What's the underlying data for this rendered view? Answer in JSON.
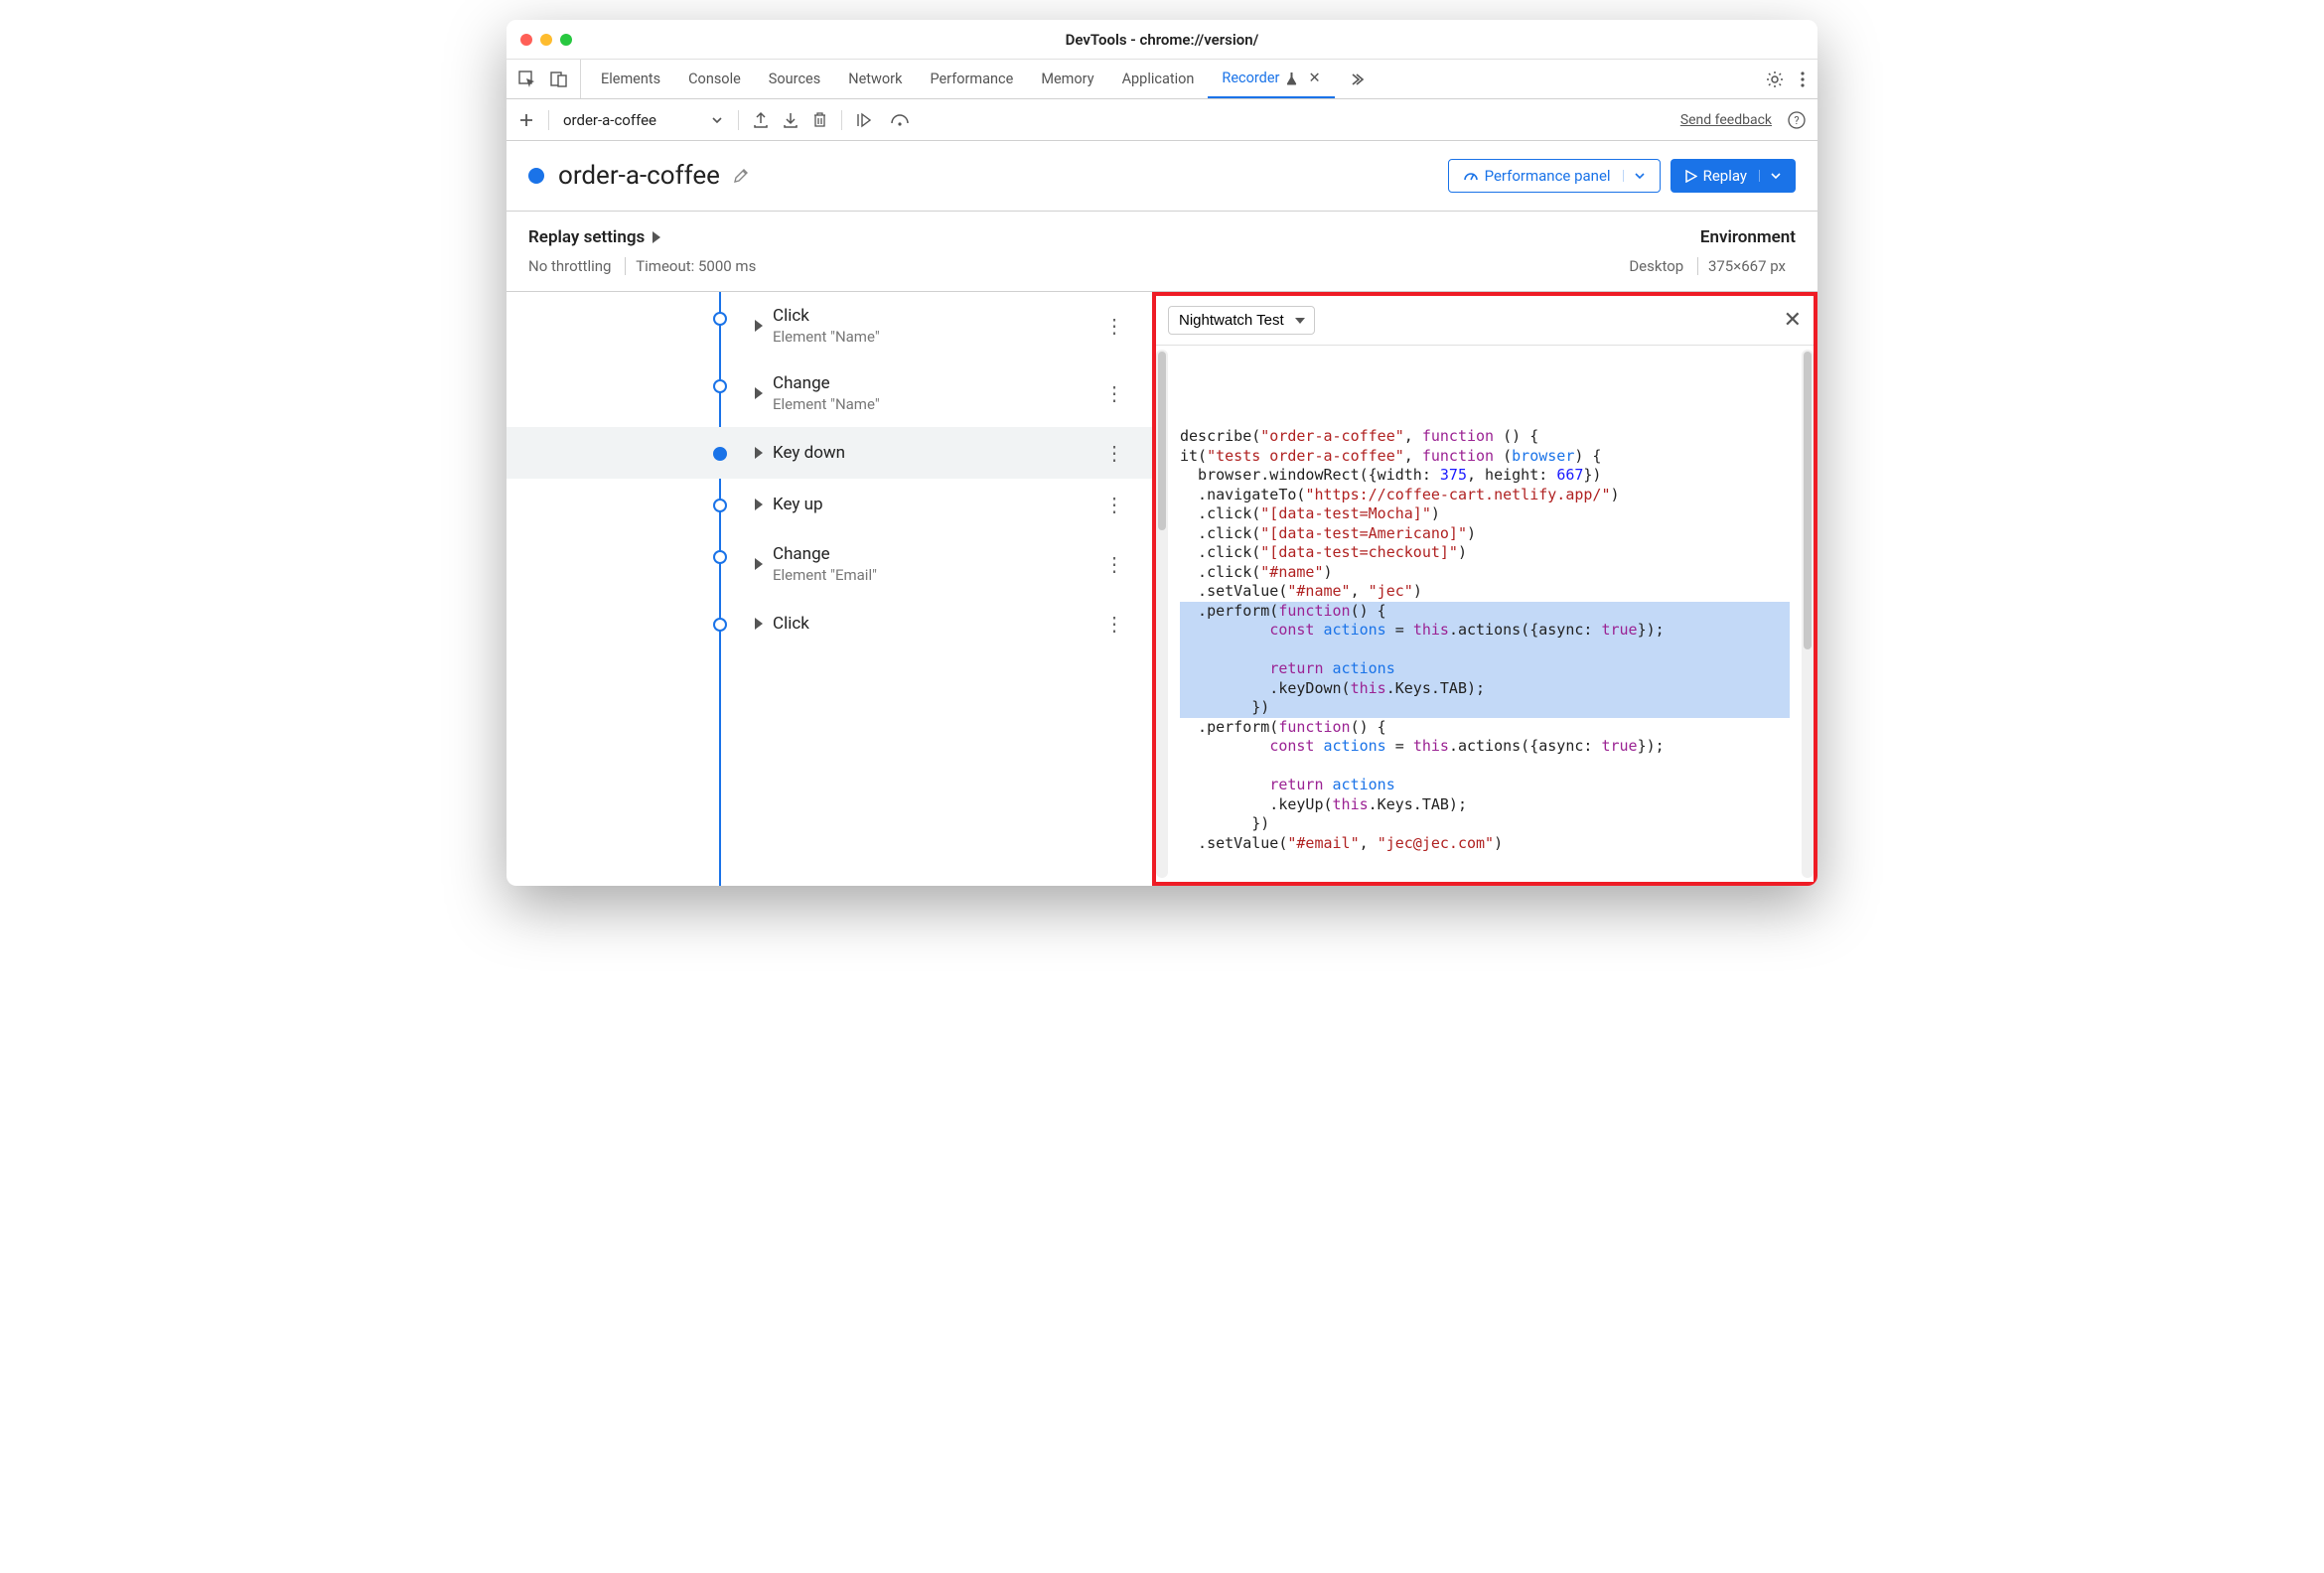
{
  "window_title": "DevTools - chrome://version/",
  "tabs": {
    "items": [
      "Elements",
      "Console",
      "Sources",
      "Network",
      "Performance",
      "Memory",
      "Application",
      "Recorder"
    ],
    "active_index": 7
  },
  "recorder_toolbar": {
    "recording_name": "order-a-coffee",
    "feedback": "Send feedback"
  },
  "header": {
    "title": "order-a-coffee",
    "perf_button": "Performance panel",
    "replay_button": "Replay"
  },
  "replay_settings": {
    "heading": "Replay settings",
    "throttling": "No throttling",
    "timeout": "Timeout: 5000 ms"
  },
  "environment": {
    "heading": "Environment",
    "device": "Desktop",
    "dimensions": "375×667 px"
  },
  "steps": [
    {
      "action": "Click",
      "elem": "Element \"Name\""
    },
    {
      "action": "Change",
      "elem": "Element \"Name\""
    },
    {
      "action": "Key down",
      "elem": ""
    },
    {
      "action": "Key up",
      "elem": ""
    },
    {
      "action": "Change",
      "elem": "Element \"Email\""
    },
    {
      "action": "Click",
      "elem": ""
    }
  ],
  "active_step_index": 2,
  "code_panel": {
    "format": "Nightwatch Test",
    "lines": [
      {
        "t": "describe(",
        "parts": [
          [
            "plain",
            "describe("
          ],
          [
            "str",
            "\"order-a-coffee\""
          ],
          [
            "plain",
            ", "
          ],
          [
            "kw",
            "function"
          ],
          [
            "plain",
            " () {"
          ]
        ]
      },
      {
        "t": "it",
        "parts": [
          [
            "plain",
            "it("
          ],
          [
            "str",
            "\"tests order-a-coffee\""
          ],
          [
            "plain",
            ", "
          ],
          [
            "kw",
            "function"
          ],
          [
            "plain",
            " ("
          ],
          [
            "id",
            "browser"
          ],
          [
            "plain",
            ") {"
          ]
        ]
      },
      {
        "t": "wr",
        "parts": [
          [
            "plain",
            "  browser.windowRect({width: "
          ],
          [
            "num",
            "375"
          ],
          [
            "plain",
            ", height: "
          ],
          [
            "num",
            "667"
          ],
          [
            "plain",
            "})"
          ]
        ]
      },
      {
        "t": "nav",
        "parts": [
          [
            "plain",
            "  .navigateTo("
          ],
          [
            "str",
            "\"https://coffee-cart.netlify.app/\""
          ],
          [
            "plain",
            ")"
          ]
        ]
      },
      {
        "t": "c1",
        "parts": [
          [
            "plain",
            "  .click("
          ],
          [
            "str",
            "\"[data-test=Mocha]\""
          ],
          [
            "plain",
            ")"
          ]
        ]
      },
      {
        "t": "c2",
        "parts": [
          [
            "plain",
            "  .click("
          ],
          [
            "str",
            "\"[data-test=Americano]\""
          ],
          [
            "plain",
            ")"
          ]
        ]
      },
      {
        "t": "c3",
        "parts": [
          [
            "plain",
            "  .click("
          ],
          [
            "str",
            "\"[data-test=checkout]\""
          ],
          [
            "plain",
            ")"
          ]
        ]
      },
      {
        "t": "c4",
        "parts": [
          [
            "plain",
            "  .click("
          ],
          [
            "str",
            "\"#name\""
          ],
          [
            "plain",
            ")"
          ]
        ]
      },
      {
        "t": "sv",
        "parts": [
          [
            "plain",
            "  .setValue("
          ],
          [
            "str",
            "\"#name\""
          ],
          [
            "plain",
            ", "
          ],
          [
            "str",
            "\"jec\""
          ],
          [
            "plain",
            ")"
          ]
        ]
      },
      {
        "t": "p1",
        "hl": true,
        "parts": [
          [
            "plain",
            "  .perform("
          ],
          [
            "kw",
            "function"
          ],
          [
            "plain",
            "() {"
          ]
        ]
      },
      {
        "t": "p1a",
        "hl": true,
        "parts": [
          [
            "plain",
            "          "
          ],
          [
            "kw",
            "const"
          ],
          [
            "plain",
            " "
          ],
          [
            "id",
            "actions"
          ],
          [
            "plain",
            " = "
          ],
          [
            "kw",
            "this"
          ],
          [
            "plain",
            ".actions({async: "
          ],
          [
            "bool",
            "true"
          ],
          [
            "plain",
            "});"
          ]
        ]
      },
      {
        "t": "blank1",
        "hl": true,
        "parts": [
          [
            "plain",
            ""
          ]
        ]
      },
      {
        "t": "p1b",
        "hl": true,
        "parts": [
          [
            "plain",
            "          "
          ],
          [
            "kw",
            "return"
          ],
          [
            "plain",
            " "
          ],
          [
            "id",
            "actions"
          ],
          [
            "plain",
            ""
          ]
        ]
      },
      {
        "t": "p1c",
        "hl": true,
        "parts": [
          [
            "plain",
            "          .keyDown("
          ],
          [
            "kw",
            "this"
          ],
          [
            "plain",
            ".Keys.TAB);"
          ]
        ]
      },
      {
        "t": "p1d",
        "hl": true,
        "parts": [
          [
            "plain",
            "        })"
          ]
        ]
      },
      {
        "t": "p2",
        "parts": [
          [
            "plain",
            "  .perform("
          ],
          [
            "kw",
            "function"
          ],
          [
            "plain",
            "() {"
          ]
        ]
      },
      {
        "t": "p2a",
        "parts": [
          [
            "plain",
            "          "
          ],
          [
            "kw",
            "const"
          ],
          [
            "plain",
            " "
          ],
          [
            "id",
            "actions"
          ],
          [
            "plain",
            " = "
          ],
          [
            "kw",
            "this"
          ],
          [
            "plain",
            ".actions({async: "
          ],
          [
            "bool",
            "true"
          ],
          [
            "plain",
            "});"
          ]
        ]
      },
      {
        "t": "blank2",
        "parts": [
          [
            "plain",
            ""
          ]
        ]
      },
      {
        "t": "p2b",
        "parts": [
          [
            "plain",
            "          "
          ],
          [
            "kw",
            "return"
          ],
          [
            "plain",
            " "
          ],
          [
            "id",
            "actions"
          ],
          [
            "plain",
            ""
          ]
        ]
      },
      {
        "t": "p2c",
        "parts": [
          [
            "plain",
            "          .keyUp("
          ],
          [
            "kw",
            "this"
          ],
          [
            "plain",
            ".Keys.TAB);"
          ]
        ]
      },
      {
        "t": "p2d",
        "parts": [
          [
            "plain",
            "        })"
          ]
        ]
      },
      {
        "t": "sv2",
        "parts": [
          [
            "plain",
            "  .setValue("
          ],
          [
            "str",
            "\"#email\""
          ],
          [
            "plain",
            ", "
          ],
          [
            "str",
            "\"jec@jec.com\""
          ],
          [
            "plain",
            ")"
          ]
        ]
      }
    ]
  }
}
